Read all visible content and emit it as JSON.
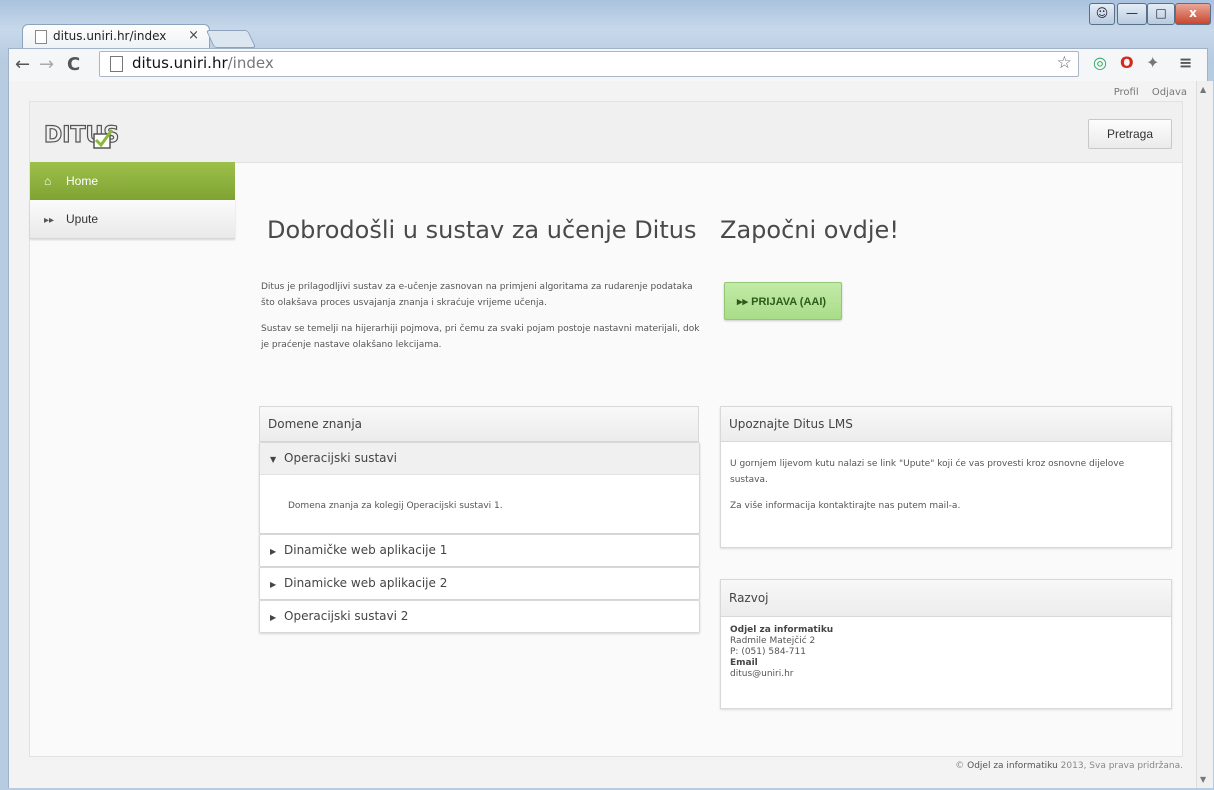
{
  "browser": {
    "tab_title": "ditus.uniri.hr/index",
    "tab_close": "×",
    "url_host": "ditus.uniri.hr",
    "url_path": "/index",
    "nav_back": "←",
    "nav_forward": "→",
    "nav_reload": "C",
    "star": "☆",
    "menu": "≡",
    "win_min": "—",
    "win_max": "□",
    "win_close": "x"
  },
  "toplinks": {
    "profil": "Profil",
    "odjava": "Odjava"
  },
  "header": {
    "search_button": "Pretraga"
  },
  "sidebar": {
    "items": [
      {
        "label": "Home"
      },
      {
        "label": "Upute"
      }
    ]
  },
  "welcome": {
    "title": "Dobrodošli u sustav za učenje Ditus",
    "paragraphs": [
      "Ditus je prilagodljivi sustav za e-učenje zasnovan na primjeni algoritama za rudarenje podataka što olakšava proces usvajanja znanja i skraćuje vrijeme učenja.",
      "Sustav se temelji na hijerarhiji pojmova, pri čemu za svaki pojam postoje nastavni materijali, dok je praćenje nastave olakšano lekcijama."
    ]
  },
  "start": {
    "title": "Započni ovdje!",
    "login_button": "PRIJAVA (AAI)"
  },
  "domains": {
    "heading": "Domene znanja",
    "items": [
      {
        "label": "Operacijski sustavi",
        "description": "Domena znanja za kolegij Operacijski sustavi 1."
      },
      {
        "label": "Dinamičke web aplikacije 1"
      },
      {
        "label": "Dinamicke web aplikacije 2"
      },
      {
        "label": "Operacijski sustavi 2"
      }
    ]
  },
  "about": {
    "heading": "Upoznajte Ditus LMS",
    "p1": "U gornjem lijevom kutu nalazi se link \"Upute\" koji će vas provesti kroz osnovne dijelove sustava.",
    "p2": "Za više informacija kontaktirajte nas putem mail-a."
  },
  "dev": {
    "heading": "Razvoj",
    "org": "Odjel za informatiku",
    "address": "Radmile Matejčić 2",
    "phone": "P: (051) 584-711",
    "email_label": "Email",
    "email": "ditus@uniri.hr"
  },
  "footer": {
    "copy": "©",
    "org": "Odjel za informatiku",
    "rest": "2013, Sva prava pridržana."
  }
}
